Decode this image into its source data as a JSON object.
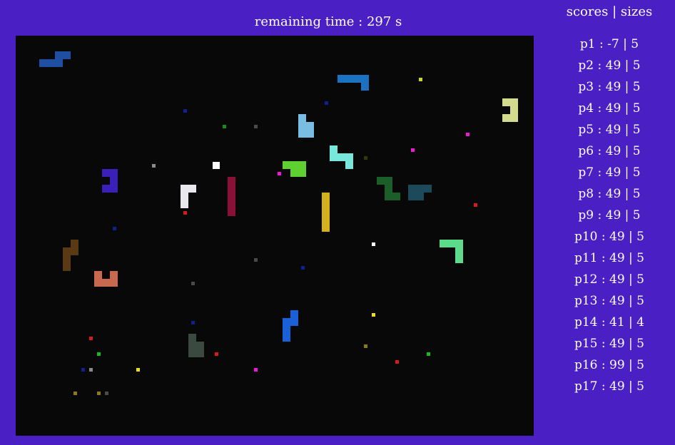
{
  "header": {
    "timer_label": "remaining time : 297 s"
  },
  "sidebar": {
    "title": "scores | sizes",
    "scores": [
      "p1 : -7 | 5",
      "p2 : 49 | 5",
      "p3 : 49 | 5",
      "p4 : 49 | 5",
      "p5 : 49 | 5",
      "p6 : 49 | 5",
      "p7 : 49 | 5",
      "p8 : 49 | 5",
      "p9 : 49 | 5",
      "p10 : 49 | 5",
      "p11 : 49 | 5",
      "p12 : 49 | 5",
      "p13 : 49 | 5",
      "p14 : 41 | 4",
      "p15 : 49 | 5",
      "p16 : 99 | 5",
      "p17 : 49 | 5"
    ]
  },
  "colors": {
    "background": "#4a1fc4",
    "board": "#080808",
    "text": "#ffffff",
    "snakes": [
      "#1f4fa3",
      "#1a72c0",
      "#79bde3",
      "#5ed032",
      "#78e8dc",
      "#d3dc8e",
      "#3a1fb8",
      "#e8e8ee",
      "#8a1038",
      "#d4b01c",
      "#1b5e2a",
      "#1d4a5a",
      "#5adc8a",
      "#5a3a12",
      "#c8684e",
      "#1a60d8",
      "#3a4a40"
    ],
    "food": [
      "#c8d81a",
      "#f018d8",
      "#10208e",
      "#1a8a1a",
      "#4a4a4a",
      "#8a8a8a",
      "#ffffff",
      "#d81a1a",
      "#e8e018",
      "#1ab81a",
      "#8a7a1a",
      "#303a0e"
    ]
  }
}
